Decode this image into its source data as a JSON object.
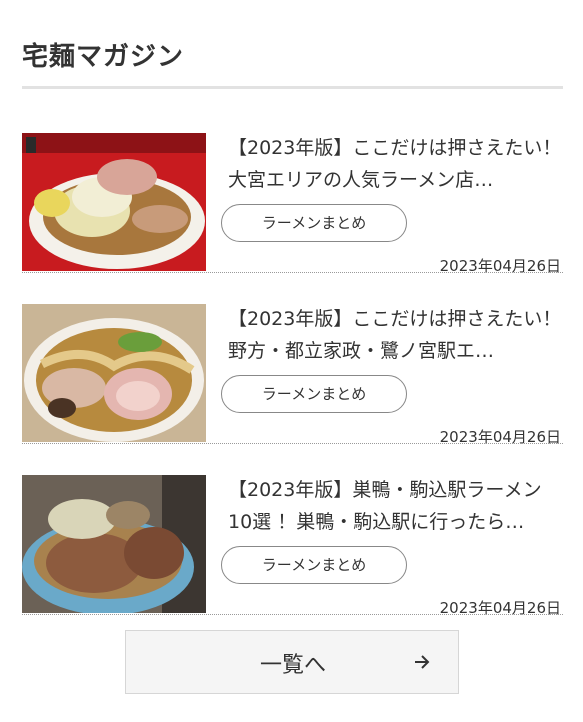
{
  "section": {
    "title": "宅麺マガジン"
  },
  "articles": [
    {
      "title": "【2023年版】ここだけは押さえたい！大宮エリアの人気ラーメン店…",
      "tag": "ラーメンまとめ",
      "date": "2023年04月26日",
      "thumb_icon": "ramen-photo-jiro-style"
    },
    {
      "title": "【2023年版】ここだけは押さえたい！野方・都立家政・鷺ノ宮駅エ…",
      "tag": "ラーメンまとめ",
      "date": "2023年04月26日",
      "thumb_icon": "ramen-photo-shoyu"
    },
    {
      "title": "【2023年版】巣鴨・駒込駅ラーメン10選 ！巣鴨・駒込駅に行ったら…",
      "tag": "ラーメンまとめ",
      "date": "2023年04月26日",
      "thumb_icon": "ramen-photo-chashu"
    }
  ],
  "more_button": {
    "label": "一覧へ",
    "icon": "arrow-right-icon"
  },
  "colors": {
    "text": "#333333",
    "rule": "#e2e2e2",
    "button_bg": "#f5f5f5"
  }
}
